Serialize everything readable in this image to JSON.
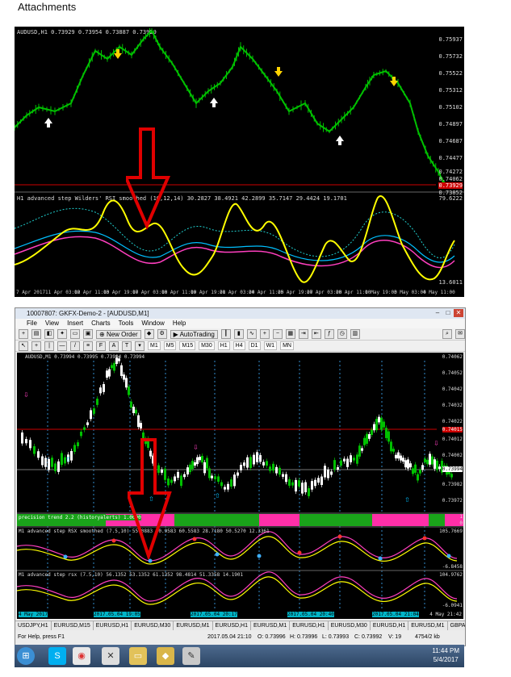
{
  "page": {
    "title": "Attachments"
  },
  "chart1": {
    "symbol_info": "AUDUSD,H1  0.73929 0.73954 0.73887 0.73929",
    "indicator_label": "H1 advanced step Wilders' RSI smoothed (10,12,14) 30.2827 38.4921 42.2899 35.7147 29.4424 19.1701",
    "price_labels": [
      "0.75937",
      "0.75732",
      "0.75522",
      "0.75312",
      "0.75102",
      "0.74897",
      "0.74687",
      "0.74477",
      "0.74272",
      "0.74062",
      "0.73929",
      "0.73852"
    ],
    "ind_labels": [
      "79.6222",
      "13.6011"
    ],
    "x_labels": [
      "7 Apr 2017",
      "11 Apr 03:00",
      "12 Apr 11:00",
      "13 Apr 19:00",
      "17 Apr 03:00",
      "18 Apr 11:00",
      "19 Apr 19:00",
      "21 Apr 03:00",
      "24 Apr 11:00",
      "25 Apr 19:00",
      "27 Apr 03:00",
      "28 Apr 11:00",
      "1 May 19:00",
      "3 May 03:00",
      "4 May 11:00"
    ]
  },
  "window": {
    "title": "10007807: GKFX-Demo-2 - [AUDUSD,M1]",
    "menu": [
      "File",
      "View",
      "Insert",
      "Charts",
      "Tools",
      "Window",
      "Help"
    ],
    "toolbar": {
      "new_order": "New Order",
      "autotrading": "AutoTrading"
    },
    "timeframes": [
      "M1",
      "M5",
      "M15",
      "M30",
      "H1",
      "H4",
      "D1",
      "W1",
      "MN"
    ],
    "chart": {
      "symbol_info": "AUDUSD,M1  0.73994 0.73995 0.73994 0.73994",
      "price_labels": [
        "0.74062",
        "0.74052",
        "0.74042",
        "0.74032",
        "0.74022",
        "0.74012",
        "0.74002",
        "0.73994",
        "0.73982",
        "0.73972"
      ],
      "red_label": "0.74015",
      "trend_label": "precision trend 2.2 (historyalerts) 1.0000",
      "ind1_label": "M1 advanced step RSX smoothed (7.5,10) 55.0883 50.9583 60.5583 28.7180 50.5270 12.3361",
      "ind1_scale": [
        "105.7669",
        "-6.8458"
      ],
      "ind2_label": "M1 advanced step rsx (7.5,10) 56.1352 53.1352 61.1352 98.4814 51.3358 14.1901",
      "ind2_scale": [
        "104.9762",
        "-6.0941"
      ],
      "trend_scale": [
        "1",
        "0"
      ],
      "date_start": "4 May 2017",
      "date_end": "4 May 21:42",
      "date_labels": [
        "2017.05.04 19:05",
        "2017.05.04 20:17",
        "2017.05.04 20:40",
        "2017.05.04 21:04"
      ]
    },
    "tabs": [
      "USDJPY,H1",
      "EURUSD,M15",
      "EURUSD,H1",
      "EURUSD,M30",
      "EURUSD,M1",
      "EURUSD,H1",
      "EURUSD,M1",
      "EURUSD,H1",
      "EURUSD,M30",
      "EURUSD,H1",
      "EURUSD,M1",
      "GBPAUD,M5",
      "US"
    ],
    "status": {
      "help": "For Help, press F1",
      "time": "2017.05.04 21:10",
      "open": "O: 0.73996",
      "high": "H: 0.73996",
      "low": "L: 0.73993",
      "close": "C: 0.73992",
      "volume": "V: 19",
      "traffic": "4754/2 kb"
    }
  },
  "taskbar": {
    "time": "11:44 PM",
    "date": "5/4/2017"
  },
  "colors": {
    "bull": "#00c000",
    "bear": "#ffffff",
    "arrow": "#e00000",
    "accent_pink": "#ff2fa8",
    "trend_green": "#1aa31a"
  }
}
